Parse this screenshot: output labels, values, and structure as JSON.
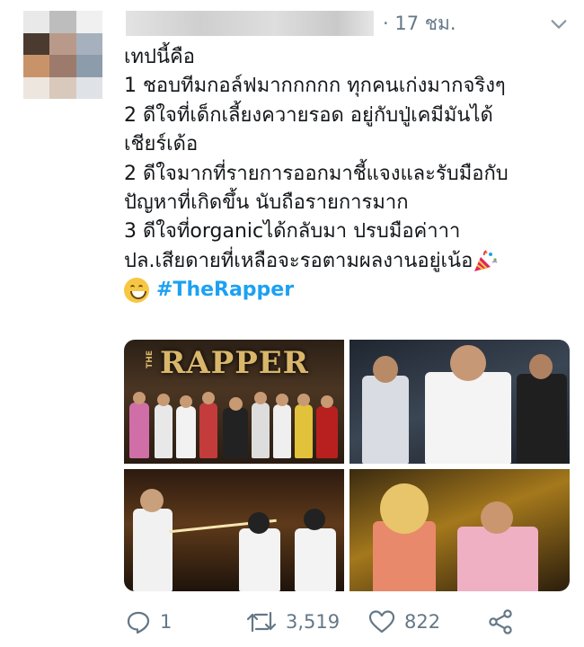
{
  "tweet": {
    "time": "· 17 ชม.",
    "lines": [
      "เทปนี้คือ",
      "1 ชอบทีมกอล์ฟมากกกกก ทุกคนเก่งมากจริงๆ",
      "2 ดีใจที่เด็กเลี้ยงควายรอด อยู่กับปู่เคมีมันได้",
      "เชียร์เด้อ",
      "2 ดีใจมากที่รายการออกมาชี้แจงและรับมือกับ",
      "ปัญหาที่เกิดขึ้น นับถือรายการมาก",
      "3 ดีใจที่organicได้กลับมา ปรบมือค่าาา",
      "ปล.เสียดายที่เหลือจะรอตามผลงานอยู่เน้อ"
    ],
    "hashtag": "#TheRapper",
    "emoji_icon": "grinning-face-emoji",
    "party_icon": "party-popper-emoji",
    "hashtag_color": "#1da1f2"
  },
  "media": {
    "tile1_title": "RAPPER",
    "tile1_prefix": "THE"
  },
  "actions": {
    "reply_count": "1",
    "retweet_count": "3,519",
    "like_count": "822",
    "icons": [
      "reply-icon",
      "retweet-icon",
      "like-icon",
      "share-icon"
    ],
    "icon_color": "#657786"
  }
}
